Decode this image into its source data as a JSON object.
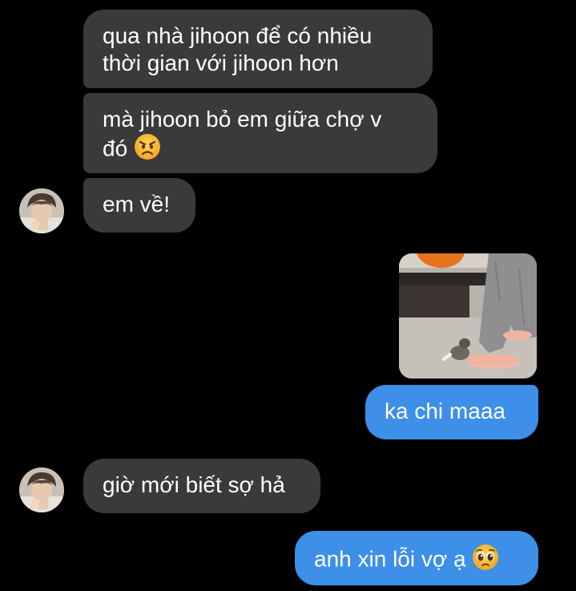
{
  "messages": [
    {
      "id": "m1",
      "side": "incoming",
      "lines": [
        "qua nhà jihoon để có nhiều",
        "thời gian với jihoon hơn"
      ]
    },
    {
      "id": "m2",
      "side": "incoming",
      "lines": [
        "mà jihoon bỏ em giữa chợ v",
        "đó"
      ],
      "emoji": "angry-face-emoji"
    },
    {
      "id": "m3",
      "side": "incoming",
      "lines": [
        "em về!"
      ]
    },
    {
      "id": "m4",
      "side": "outgoing",
      "type": "image",
      "alt": "cat playing at a person's foot"
    },
    {
      "id": "m5",
      "side": "outgoing",
      "lines": [
        "ka chi maaa"
      ]
    },
    {
      "id": "m6",
      "side": "incoming",
      "lines": [
        "giờ mới biết sợ hả"
      ]
    },
    {
      "id": "m7",
      "side": "outgoing",
      "lines": [
        "anh xin lỗi vợ ạ"
      ],
      "emoji": "pleading-face-emoji"
    }
  ],
  "colors": {
    "background": "#000000",
    "incoming_bubble": "#3a3a3c",
    "outgoing_bubble": "#3d8fe8",
    "text": "#ffffff"
  }
}
